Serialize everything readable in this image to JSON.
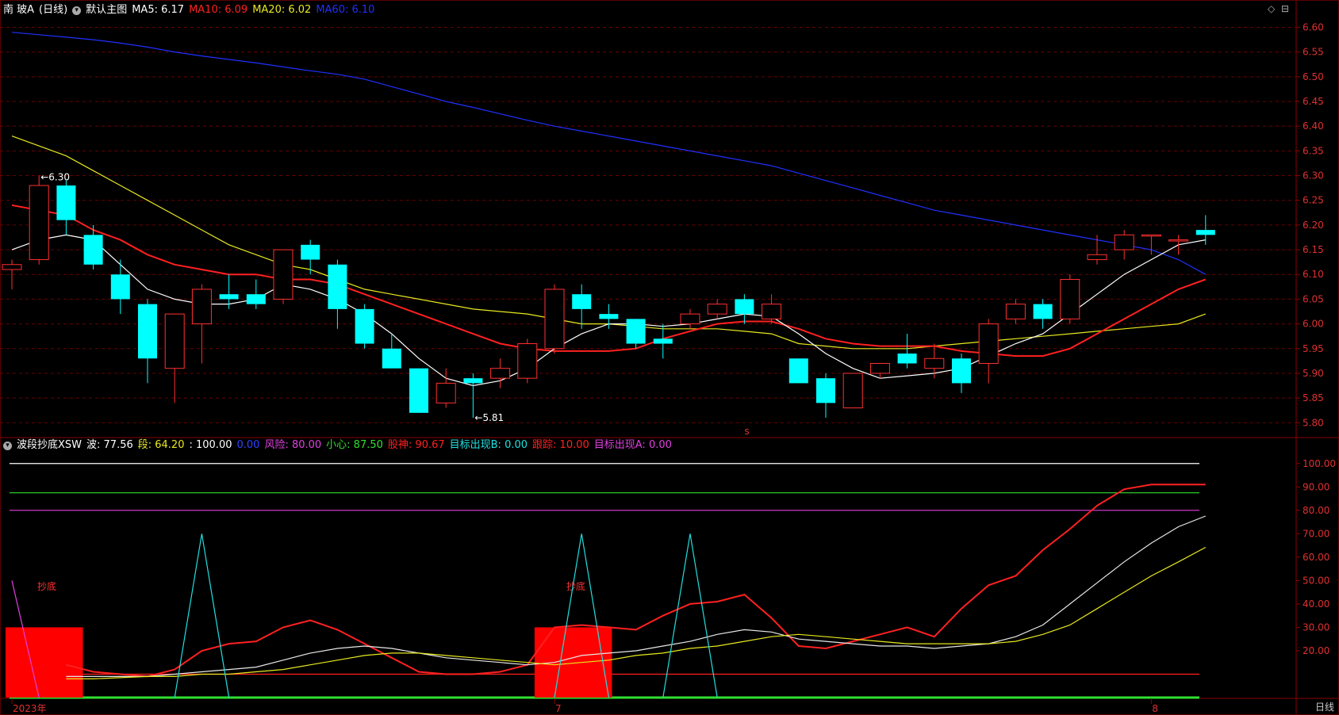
{
  "header": {
    "stock_name": "南 玻A",
    "period_paren": "(日线)",
    "template": "默认主图",
    "ma5": {
      "label": "MA5:",
      "value": "6.17",
      "color": "#ffffff"
    },
    "ma10": {
      "label": "MA10:",
      "value": "6.09",
      "color": "#ff2020"
    },
    "ma20": {
      "label": "MA20:",
      "value": "6.02",
      "color": "#e8e820"
    },
    "ma60": {
      "label": "MA60:",
      "value": "6.10",
      "color": "#2030ff"
    }
  },
  "indicator_header": {
    "name": "波段抄底XSW",
    "items": [
      {
        "label": "波:",
        "value": "77.56",
        "color": "#ffffff"
      },
      {
        "label": "段:",
        "value": "64.20",
        "color": "#e8e820"
      },
      {
        "label": ":",
        "value": "100.00",
        "color": "#ffffff"
      },
      {
        "label": "",
        "value": "0.00",
        "color": "#3040ff"
      },
      {
        "label": "风险:",
        "value": "80.00",
        "color": "#e040e0"
      },
      {
        "label": "小心:",
        "value": "87.50",
        "color": "#30e030"
      },
      {
        "label": "股神:",
        "value": "90.67",
        "color": "#ff2020"
      },
      {
        "label": "目标出现B:",
        "value": "0.00",
        "color": "#20e0e0"
      },
      {
        "label": "跟踪:",
        "value": "10.00",
        "color": "#ff2020"
      },
      {
        "label": "目标出现A:",
        "value": "0.00",
        "color": "#e040e0"
      }
    ]
  },
  "period_label": "日线",
  "colors": {
    "up": "#ff3030",
    "down": "#00ffff",
    "grid": "#6a0000",
    "axis_text": "#e03030"
  },
  "chart_data": [
    {
      "type": "candlestick",
      "ylim": [
        5.77,
        6.62
      ],
      "yticks": [
        "6.60",
        "6.55",
        "6.50",
        "6.45",
        "6.40",
        "6.35",
        "6.30",
        "6.25",
        "6.20",
        "6.15",
        "6.10",
        "6.05",
        "6.00",
        "5.95",
        "5.90",
        "5.85",
        "5.80"
      ],
      "annotations": {
        "high_label": "6.30",
        "low_label": "5.81",
        "marker": "s"
      },
      "candles": [
        {
          "o": 6.11,
          "h": 6.13,
          "l": 6.07,
          "c": 6.12
        },
        {
          "o": 6.13,
          "h": 6.3,
          "l": 6.12,
          "c": 6.28
        },
        {
          "o": 6.28,
          "h": 6.29,
          "l": 6.18,
          "c": 6.21
        },
        {
          "o": 6.18,
          "h": 6.2,
          "l": 6.11,
          "c": 6.12
        },
        {
          "o": 6.1,
          "h": 6.13,
          "l": 6.02,
          "c": 6.05
        },
        {
          "o": 6.04,
          "h": 6.05,
          "l": 5.88,
          "c": 5.93
        },
        {
          "o": 5.91,
          "h": 6.02,
          "l": 5.84,
          "c": 6.02
        },
        {
          "o": 6.0,
          "h": 6.08,
          "l": 5.92,
          "c": 6.07
        },
        {
          "o": 6.06,
          "h": 6.1,
          "l": 6.03,
          "c": 6.05
        },
        {
          "o": 6.06,
          "h": 6.09,
          "l": 6.03,
          "c": 6.04
        },
        {
          "o": 6.05,
          "h": 6.15,
          "l": 6.04,
          "c": 6.15
        },
        {
          "o": 6.16,
          "h": 6.17,
          "l": 6.1,
          "c": 6.13
        },
        {
          "o": 6.12,
          "h": 6.13,
          "l": 5.99,
          "c": 6.03
        },
        {
          "o": 6.03,
          "h": 6.04,
          "l": 5.95,
          "c": 5.96
        },
        {
          "o": 5.95,
          "h": 5.98,
          "l": 5.91,
          "c": 5.91
        },
        {
          "o": 5.91,
          "h": 5.91,
          "l": 5.82,
          "c": 5.82
        },
        {
          "o": 5.84,
          "h": 5.91,
          "l": 5.83,
          "c": 5.88
        },
        {
          "o": 5.89,
          "h": 5.9,
          "l": 5.81,
          "c": 5.88
        },
        {
          "o": 5.89,
          "h": 5.93,
          "l": 5.87,
          "c": 5.91
        },
        {
          "o": 5.89,
          "h": 5.97,
          "l": 5.88,
          "c": 5.96
        },
        {
          "o": 5.95,
          "h": 6.08,
          "l": 5.94,
          "c": 6.07
        },
        {
          "o": 6.06,
          "h": 6.08,
          "l": 5.99,
          "c": 6.03
        },
        {
          "o": 6.02,
          "h": 6.04,
          "l": 5.99,
          "c": 6.01
        },
        {
          "o": 6.01,
          "h": 6.01,
          "l": 5.95,
          "c": 5.96
        },
        {
          "o": 5.97,
          "h": 6.0,
          "l": 5.93,
          "c": 5.96
        },
        {
          "o": 6.0,
          "h": 6.03,
          "l": 5.99,
          "c": 6.02
        },
        {
          "o": 6.02,
          "h": 6.05,
          "l": 6.01,
          "c": 6.04
        },
        {
          "o": 6.05,
          "h": 6.06,
          "l": 6.0,
          "c": 6.02
        },
        {
          "o": 6.01,
          "h": 6.06,
          "l": 6.0,
          "c": 6.04
        },
        {
          "o": 5.93,
          "h": 5.93,
          "l": 5.88,
          "c": 5.88
        },
        {
          "o": 5.89,
          "h": 5.9,
          "l": 5.81,
          "c": 5.84
        },
        {
          "o": 5.83,
          "h": 5.9,
          "l": 5.83,
          "c": 5.9
        },
        {
          "o": 5.9,
          "h": 5.92,
          "l": 5.89,
          "c": 5.92
        },
        {
          "o": 5.94,
          "h": 5.98,
          "l": 5.91,
          "c": 5.92
        },
        {
          "o": 5.91,
          "h": 5.96,
          "l": 5.89,
          "c": 5.93
        },
        {
          "o": 5.93,
          "h": 5.94,
          "l": 5.86,
          "c": 5.88
        },
        {
          "o": 5.92,
          "h": 6.01,
          "l": 5.88,
          "c": 6.0
        },
        {
          "o": 6.01,
          "h": 6.05,
          "l": 6.0,
          "c": 6.04
        },
        {
          "o": 6.04,
          "h": 6.05,
          "l": 5.99,
          "c": 6.01
        },
        {
          "o": 6.01,
          "h": 6.1,
          "l": 6.0,
          "c": 6.09
        },
        {
          "o": 6.13,
          "h": 6.18,
          "l": 6.12,
          "c": 6.14
        },
        {
          "o": 6.15,
          "h": 6.19,
          "l": 6.13,
          "c": 6.18
        },
        {
          "o": 6.18,
          "h": 6.18,
          "l": 6.14,
          "c": 6.18
        },
        {
          "o": 6.17,
          "h": 6.18,
          "l": 6.14,
          "c": 6.17
        },
        {
          "o": 6.19,
          "h": 6.22,
          "l": 6.16,
          "c": 6.18
        }
      ],
      "ma_series": [
        {
          "name": "MA60",
          "color": "#2030ff",
          "values": [
            6.59,
            6.585,
            6.58,
            6.575,
            6.568,
            6.56,
            6.55,
            6.542,
            6.535,
            6.528,
            6.52,
            6.512,
            6.505,
            6.495,
            6.48,
            6.465,
            6.45,
            6.438,
            6.425,
            6.412,
            6.4,
            6.39,
            6.38,
            6.37,
            6.36,
            6.35,
            6.34,
            6.33,
            6.32,
            6.305,
            6.29,
            6.275,
            6.26,
            6.245,
            6.23,
            6.22,
            6.21,
            6.2,
            6.19,
            6.18,
            6.17,
            6.16,
            6.15,
            6.13,
            6.1
          ]
        },
        {
          "name": "MA20",
          "color": "#e8e820",
          "values": [
            6.38,
            6.36,
            6.34,
            6.31,
            6.28,
            6.25,
            6.22,
            6.19,
            6.16,
            6.14,
            6.12,
            6.11,
            6.09,
            6.07,
            6.06,
            6.05,
            6.04,
            6.03,
            6.025,
            6.02,
            6.01,
            6.0,
            6.0,
            5.995,
            5.99,
            5.99,
            5.99,
            5.985,
            5.98,
            5.96,
            5.955,
            5.95,
            5.95,
            5.95,
            5.955,
            5.96,
            5.965,
            5.97,
            5.975,
            5.98,
            5.985,
            5.99,
            5.995,
            6.0,
            6.02
          ]
        },
        {
          "name": "MA10",
          "color": "#ff2020",
          "values": [
            6.24,
            6.23,
            6.22,
            6.19,
            6.17,
            6.14,
            6.12,
            6.11,
            6.1,
            6.1,
            6.09,
            6.09,
            6.08,
            6.06,
            6.04,
            6.02,
            6.0,
            5.98,
            5.96,
            5.95,
            5.945,
            5.945,
            5.945,
            5.95,
            5.97,
            5.985,
            6.0,
            6.005,
            6.005,
            5.99,
            5.97,
            5.96,
            5.955,
            5.955,
            5.955,
            5.945,
            5.94,
            5.935,
            5.935,
            5.95,
            5.98,
            6.01,
            6.04,
            6.07,
            6.09
          ]
        },
        {
          "name": "MA5",
          "color": "#ffffff",
          "values": [
            6.15,
            6.17,
            6.18,
            6.17,
            6.12,
            6.07,
            6.05,
            6.04,
            6.04,
            6.05,
            6.08,
            6.07,
            6.05,
            6.02,
            5.98,
            5.93,
            5.89,
            5.875,
            5.885,
            5.91,
            5.95,
            5.98,
            6.0,
            6.0,
            5.995,
            6.0,
            6.01,
            6.02,
            6.015,
            5.98,
            5.94,
            5.91,
            5.89,
            5.895,
            5.9,
            5.91,
            5.935,
            5.96,
            5.98,
            6.02,
            6.06,
            6.1,
            6.13,
            6.16,
            6.17
          ]
        }
      ]
    },
    {
      "type": "line",
      "ylim": [
        0,
        105
      ],
      "yticks": [
        "100.00",
        "90.00",
        "80.00",
        "70.00",
        "60.00",
        "50.00",
        "40.00",
        "30.00",
        "20.00"
      ],
      "x_labels": [
        {
          "index": 0,
          "text": "2023年"
        },
        {
          "index": 20,
          "text": "7"
        },
        {
          "index": 42,
          "text": "8"
        }
      ],
      "hlines": [
        {
          "value": 100,
          "color": "#ffffff"
        },
        {
          "value": 87.5,
          "color": "#30e030"
        },
        {
          "value": 80,
          "color": "#e040e0"
        },
        {
          "value": 10,
          "color": "#ff2020"
        },
        {
          "value": 0,
          "color": "#30e030"
        }
      ],
      "bars": [
        {
          "start": 0,
          "end": 2.5,
          "value": 30,
          "label": "抄底",
          "color": "#ff0000"
        },
        {
          "start": 19.5,
          "end": 22,
          "value": 30,
          "label": "抄底",
          "color": "#ff0000"
        }
      ],
      "series": [
        {
          "name": "股神",
          "color": "#ff2020",
          "values": [
            null,
            null,
            14,
            11,
            10,
            9,
            12,
            20,
            23,
            24,
            30,
            33,
            29,
            23,
            17,
            11,
            10,
            10,
            11,
            14,
            30,
            31,
            30,
            29,
            35,
            40,
            41,
            44,
            34,
            22,
            21,
            24,
            27,
            30,
            26,
            38,
            48,
            52,
            63,
            72,
            82,
            89,
            91,
            91,
            91
          ]
        },
        {
          "name": "波",
          "color": "#e8e8e8",
          "values": [
            null,
            null,
            9,
            9,
            9,
            9,
            10,
            11,
            12,
            13,
            16,
            19,
            21,
            22,
            21,
            19,
            17,
            16,
            15,
            14,
            15,
            18,
            19,
            20,
            22,
            24,
            27,
            29,
            28,
            25,
            24,
            23,
            22,
            22,
            21,
            22,
            23,
            26,
            31,
            40,
            49,
            58,
            66,
            73,
            77.56
          ]
        },
        {
          "name": "段",
          "color": "#e8e820",
          "values": [
            null,
            null,
            8,
            8,
            8.5,
            9,
            9,
            10,
            10,
            11,
            12,
            14,
            16,
            18,
            19,
            19,
            18,
            17,
            16,
            15,
            14,
            15,
            16,
            18,
            19,
            21,
            22,
            24,
            26,
            27,
            26,
            25,
            24,
            23,
            23,
            23,
            23,
            24,
            27,
            31,
            38,
            45,
            52,
            58,
            64.2
          ]
        },
        {
          "name": "目标出现A",
          "color": "#e040e0",
          "values": [
            50,
            0,
            null,
            null,
            null,
            null,
            null,
            null,
            null,
            null,
            null,
            null,
            null,
            null,
            null,
            null,
            null,
            null,
            null,
            null,
            null,
            null,
            null,
            null,
            null,
            null,
            null,
            null,
            null,
            null,
            null,
            null,
            null,
            null,
            null,
            null,
            null,
            null,
            null,
            null,
            null,
            null,
            null,
            null,
            null
          ]
        },
        {
          "name": "目标出现B",
          "color": "#20e0e0",
          "values": [
            null,
            null,
            null,
            null,
            null,
            null,
            0,
            70,
            0,
            null,
            null,
            null,
            null,
            null,
            null,
            null,
            null,
            null,
            null,
            null,
            0,
            70,
            0,
            null,
            0,
            70,
            0,
            null,
            null,
            null,
            null,
            null,
            null,
            null,
            null,
            null,
            null,
            null,
            null,
            null,
            null,
            null,
            null,
            null,
            null
          ]
        }
      ]
    }
  ]
}
